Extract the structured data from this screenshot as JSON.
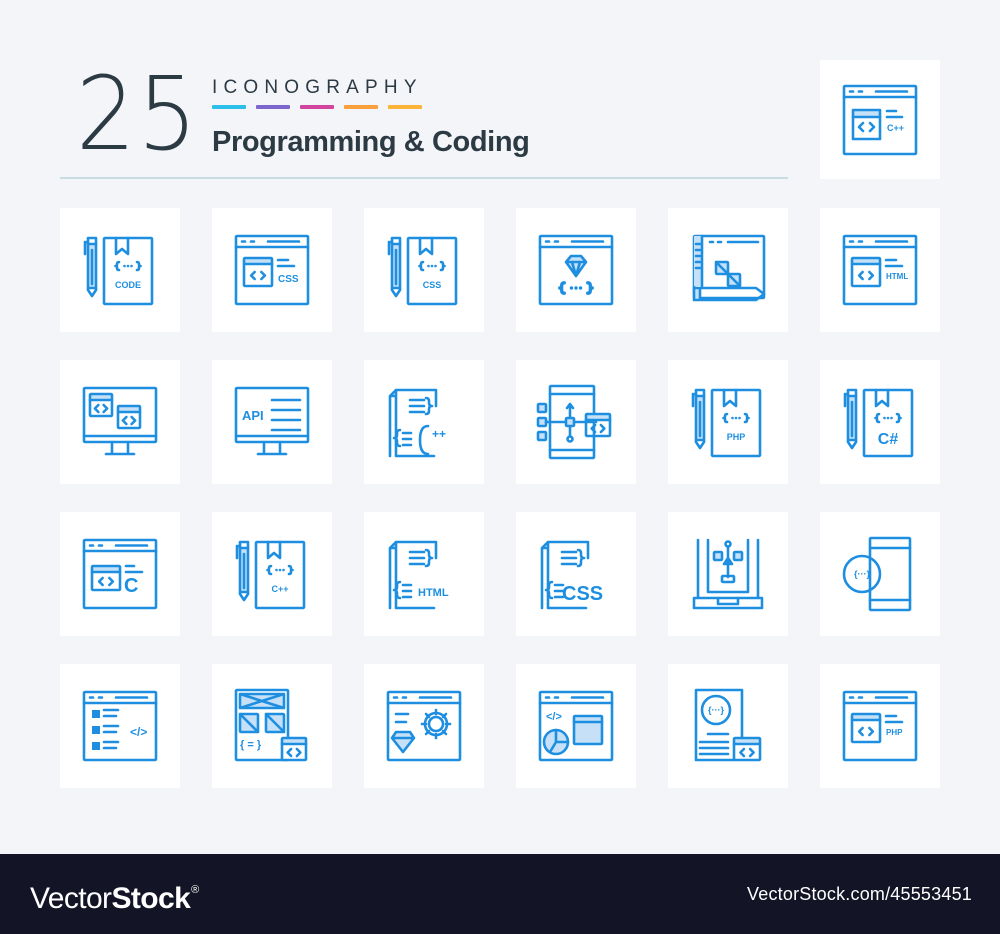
{
  "header": {
    "count": "25",
    "brand": "ICONOGRAPHY",
    "title": "Programming & Coding",
    "stripe_colors": [
      "#2cbfe9",
      "#7d67cc",
      "#d2459e",
      "#fb9f3c",
      "#fbb33a"
    ]
  },
  "theme": {
    "icon_color": "#1e8fe0",
    "icon_fill": "#c5e0f7",
    "background": "#f3f5f9",
    "tile_background": "#ffffff",
    "footer_background": "#131425"
  },
  "featured_icon": {
    "name": "browser-cpp-icon",
    "label": "C++"
  },
  "icons": [
    {
      "name": "code-book-pencil-icon",
      "label": "CODE"
    },
    {
      "name": "browser-css-icon",
      "label": "CSS"
    },
    {
      "name": "css-book-pencil-icon",
      "label": "CSS"
    },
    {
      "name": "browser-ruby-icon",
      "label": "{ ··· }"
    },
    {
      "name": "design-browser-pencil-icon",
      "label": ""
    },
    {
      "name": "browser-html-icon",
      "label": "HTML"
    },
    {
      "name": "monitor-code-windows-icon",
      "label": ""
    },
    {
      "name": "monitor-api-icon",
      "label": "API"
    },
    {
      "name": "cpp-file-icon",
      "label": "C++"
    },
    {
      "name": "mobile-flowchart-icon",
      "label": ""
    },
    {
      "name": "php-book-pencil-icon",
      "label": "PHP"
    },
    {
      "name": "csharp-book-pencil-icon",
      "label": "C#"
    },
    {
      "name": "browser-c-icon",
      "label": "C"
    },
    {
      "name": "cpp-book-pencil-icon",
      "label": "C++"
    },
    {
      "name": "html-file-icon",
      "label": "HTML"
    },
    {
      "name": "css-file-icon",
      "label": "CSS"
    },
    {
      "name": "laptop-flowchart-icon",
      "label": ""
    },
    {
      "name": "mobile-code-badge-icon",
      "label": "{···}"
    },
    {
      "name": "browser-code-list-icon",
      "label": "</>"
    },
    {
      "name": "wireframe-code-icon",
      "label": "{ = }"
    },
    {
      "name": "browser-ruby-gear-icon",
      "label": ""
    },
    {
      "name": "browser-chart-code-icon",
      "label": "</>"
    },
    {
      "name": "document-code-badge-icon",
      "label": "{···}"
    },
    {
      "name": "browser-php-icon",
      "label": "PHP"
    }
  ],
  "footer": {
    "logo_light": "Vector",
    "logo_bold": "Stock",
    "logo_mark": "®",
    "reference": "VectorStock.com/45553451"
  }
}
